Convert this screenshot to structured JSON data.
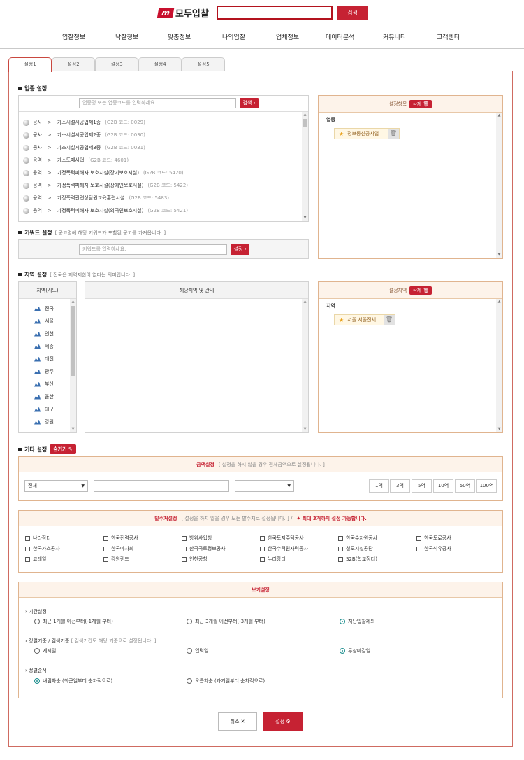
{
  "header": {
    "logo_mark": "m",
    "logo_text": "모두입찰",
    "search_button": "검색"
  },
  "nav": [
    "입찰정보",
    "낙찰정보",
    "맞춤정보",
    "나의입찰",
    "업체정보",
    "데이터분석",
    "커뮤니티",
    "고객센터"
  ],
  "tabs": [
    "설정1",
    "설정2",
    "설정3",
    "설정4",
    "설정5"
  ],
  "industry": {
    "title": "업종 설정",
    "search_placeholder": "업종명 또는 업종코드를 입력하세요.",
    "search_button": "검색 ›",
    "items": [
      {
        "type": "공사",
        "name": "가스시설시공업제1종",
        "code": "(G2B 코드: 0029)"
      },
      {
        "type": "공사",
        "name": "가스시설시공업제2종",
        "code": "(G2B 코드: 0030)"
      },
      {
        "type": "공사",
        "name": "가스시설시공업제3종",
        "code": "(G2B 코드: 0031)"
      },
      {
        "type": "용역",
        "name": "가스도매사업",
        "code": "(G2B 코드: 4601)"
      },
      {
        "type": "용역",
        "name": "가정폭력피해자 보호시설(장기보호시설)",
        "code": "(G2B 코드: 5420)"
      },
      {
        "type": "용역",
        "name": "가정폭력피해자 보호시설(장애인보호시설)",
        "code": "(G2B 코드: 5422)"
      },
      {
        "type": "용역",
        "name": "가정폭력관련상담원교육훈련시설",
        "code": "(G2B 코드: 5483)"
      },
      {
        "type": "용역",
        "name": "가정폭력피해자 보호시설(외국인보호시설)",
        "code": "(G2B 코드: 5421)"
      }
    ],
    "selected_head": "설정항목",
    "delete_button": "삭제 🗑",
    "selected_label": "업종",
    "selected_items": [
      "정보통신공사업"
    ]
  },
  "keyword": {
    "title": "키워드 설정",
    "note": "[ 공고명에 해당 키워드가 포함된 공고를 가져옵니다. ]",
    "placeholder": "키워드를 입력하세요.",
    "button": "설정 ›"
  },
  "region": {
    "title": "지역 설정",
    "note": "[ 전국은 지역제한이 없다는 의미입니다. ]",
    "list_head": "지역(시도)",
    "list": [
      "전국",
      "서울",
      "인천",
      "세종",
      "대전",
      "광주",
      "부산",
      "울산",
      "대구",
      "강원"
    ],
    "sub_head": "해당지역 및 관내",
    "selected_head": "설정지역",
    "delete_button": "삭제 🗑",
    "selected_label": "지역",
    "selected_items": [
      "서울 서울전체"
    ]
  },
  "etc": {
    "title": "기타 설정",
    "hide_button": "숨기기 ✎",
    "amount": {
      "head": "금액설정",
      "note": "[ 설정을 하지 않을 경우 전체금액으로 설정됩니다. ]",
      "select_value": "전체",
      "buttons": [
        "1억",
        "3억",
        "5억",
        "10억",
        "50억",
        "100억"
      ]
    },
    "orderer": {
      "head": "발주처설정",
      "note": "[ 설정을 하지 않을 경우 모든 발주처로 설정됩니다. ] /",
      "warn": "✦ 최대 3개까지 설정 가능합니다.",
      "options": [
        [
          "나라장터",
          "한국전력공사",
          "방위사업청",
          "한국토지주택공사",
          "한국수자원공사",
          "한국도로공사"
        ],
        [
          "한국가스공사",
          "한국마사회",
          "한국국토정보공사",
          "한국수력원자력공사",
          "철도시설공단",
          "한국석유공사"
        ],
        [
          "코레일",
          "강원랜드",
          "인천공항",
          "누리장터",
          "S2B(학교장터)"
        ]
      ]
    }
  },
  "view": {
    "head": "보기설정",
    "period": {
      "title": "› 기간설정",
      "options": [
        "최근 1개월 이전부터(-1개월 부터)",
        "최근 3개월 이전부터(-3개월 부터)",
        "지난입찰제외"
      ],
      "selected": 2
    },
    "sortbase": {
      "title": "› 정렬기준 / 검색기준",
      "note": "[ 검색기간도 해당 기준으로 설정됩니다. ]",
      "options": [
        "게시일",
        "입력일",
        "투찰마감일"
      ],
      "selected": 2
    },
    "order": {
      "title": "› 정렬순서",
      "options": [
        "내림차순 (최근일부터 순차적으로)",
        "오름차순 (과거일부터 순차적으로)"
      ],
      "selected": 0
    }
  },
  "footer": {
    "cancel": "취소 ✕",
    "ok": "설정 ⚙"
  }
}
